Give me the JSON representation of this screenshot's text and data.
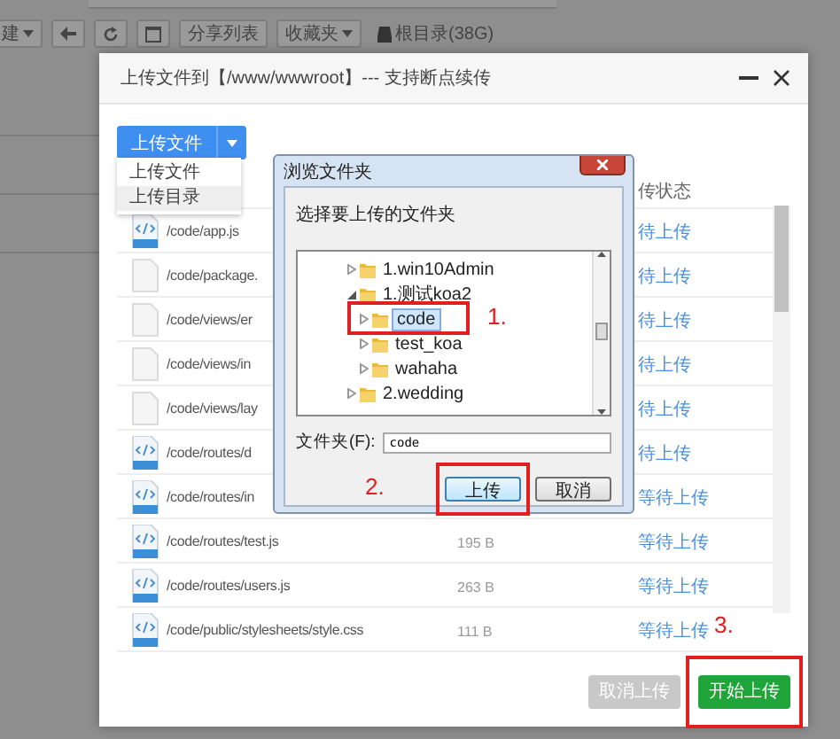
{
  "toolbar": [
    {
      "kind": "menu",
      "label": "建"
    },
    {
      "kind": "back"
    },
    {
      "kind": "refresh"
    },
    {
      "kind": "square"
    },
    {
      "kind": "text",
      "label": "分享列表"
    },
    {
      "kind": "menu",
      "label": "收藏夹"
    },
    {
      "kind": "disk",
      "label": "根目录(38G)"
    }
  ],
  "upload_dialog": {
    "title": "上传文件到【/www/wwwroot】--- 支持断点续传",
    "upload_button": "上传文件",
    "menu": [
      {
        "label": "上传文件",
        "selected": false
      },
      {
        "label": "上传目录",
        "selected": true
      }
    ],
    "status_header": "传状态",
    "files": [
      {
        "name": "/code/app.js",
        "kind": "code",
        "status": "待上传"
      },
      {
        "name": "/code/package.",
        "kind": "plain",
        "status": "待上传"
      },
      {
        "name": "/code/views/er",
        "kind": "plain",
        "status": "待上传"
      },
      {
        "name": "/code/views/in",
        "kind": "plain",
        "status": "待上传"
      },
      {
        "name": "/code/views/lay",
        "kind": "plain",
        "status": "待上传"
      },
      {
        "name": "/code/routes/d",
        "kind": "code",
        "status": "待上传"
      },
      {
        "name": "/code/routes/in",
        "kind": "code",
        "status": "等待上传"
      },
      {
        "name": "/code/routes/test.js",
        "kind": "code",
        "size": "195 B",
        "status": "等待上传"
      },
      {
        "name": "/code/routes/users.js",
        "kind": "code",
        "size": "263 B",
        "status": "等待上传"
      },
      {
        "name": "/code/public/stylesheets/style.css",
        "kind": "code",
        "size": "111 B",
        "status": "等待上传"
      }
    ],
    "cancel_button": {
      "label": "取消上传",
      "disabled": true
    },
    "start_button": {
      "label": "开始上传",
      "disabled": false,
      "callout": "3."
    }
  },
  "browse_dialog": {
    "title": "浏览文件夹",
    "prompt": "选择要上传的文件夹",
    "tree": [
      {
        "label": "1.win10Admin",
        "expanded": false,
        "selected": false
      },
      {
        "label": "1.测试koa2",
        "expanded": true,
        "selected": false,
        "children": [
          {
            "label": "code",
            "expanded": false,
            "selected": true,
            "callout": "1."
          },
          {
            "label": "test_koa",
            "expanded": false,
            "selected": false
          },
          {
            "label": "wahaha",
            "expanded": false,
            "selected": false
          }
        ]
      },
      {
        "label": "2.wedding",
        "expanded": false,
        "selected": false
      }
    ],
    "folder_label": "文件夹(F):",
    "folder_value": "code",
    "ok_button": {
      "label": "上传",
      "callout": "2."
    },
    "cancel_button": {
      "label": "取消"
    }
  }
}
